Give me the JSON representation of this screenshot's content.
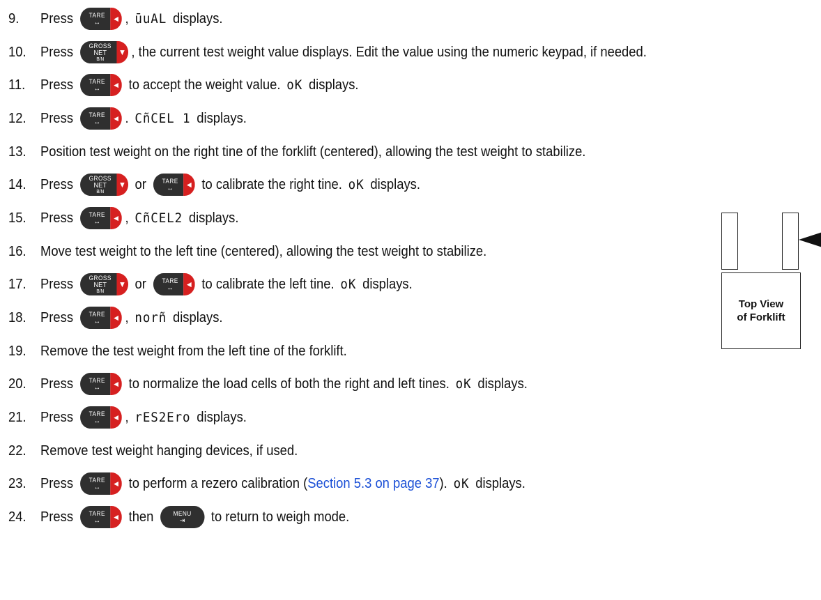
{
  "keys": {
    "tare": {
      "l1": "TARE",
      "l2": "↔",
      "cap": "◄"
    },
    "gross": {
      "l1": "GROSS",
      "l2": "NET",
      "l3": "B/N",
      "cap": "▼"
    },
    "menu": {
      "l1": "MENU",
      "l2": "⇥"
    }
  },
  "steps": [
    {
      "num": "9.",
      "parts": [
        {
          "t": "Press "
        },
        {
          "k": "tare"
        },
        {
          "t": ", "
        },
        {
          "s": "ūuAL"
        },
        {
          "t": " displays."
        }
      ]
    },
    {
      "num": "10.",
      "parts": [
        {
          "t": "Press "
        },
        {
          "k": "gross"
        },
        {
          "t": ", the current test weight value displays. Edit the value using the numeric keypad, if needed."
        }
      ]
    },
    {
      "num": "11.",
      "parts": [
        {
          "t": "Press "
        },
        {
          "k": "tare"
        },
        {
          "t": " to accept the weight value. "
        },
        {
          "s": "oK"
        },
        {
          "t": " displays."
        }
      ]
    },
    {
      "num": "12.",
      "parts": [
        {
          "t": "Press "
        },
        {
          "k": "tare"
        },
        {
          "t": ". "
        },
        {
          "s": "CñCEL 1"
        },
        {
          "t": " displays."
        }
      ]
    },
    {
      "num": "13.",
      "parts": [
        {
          "t": "Position test weight on the right tine of the forklift (centered), allowing the test weight to stabilize."
        }
      ]
    },
    {
      "num": "14.",
      "parts": [
        {
          "t": "Press "
        },
        {
          "k": "gross"
        },
        {
          "t": " or "
        },
        {
          "k": "tare"
        },
        {
          "t": " to calibrate the right tine. "
        },
        {
          "s": "oK"
        },
        {
          "t": " displays."
        }
      ]
    },
    {
      "num": "15.",
      "parts": [
        {
          "t": "Press "
        },
        {
          "k": "tare"
        },
        {
          "t": ", "
        },
        {
          "s": "CñCEL2"
        },
        {
          "t": " displays."
        }
      ]
    },
    {
      "num": "16.",
      "parts": [
        {
          "t": "Move test weight to the left tine (centered), allowing the test weight to stabilize."
        }
      ]
    },
    {
      "num": "17.",
      "parts": [
        {
          "t": "Press "
        },
        {
          "k": "gross"
        },
        {
          "t": " or "
        },
        {
          "k": "tare"
        },
        {
          "t": " to calibrate the left tine. "
        },
        {
          "s": "oK"
        },
        {
          "t": " displays."
        }
      ]
    },
    {
      "num": "18.",
      "parts": [
        {
          "t": "Press "
        },
        {
          "k": "tare"
        },
        {
          "t": ", "
        },
        {
          "s": "norñ"
        },
        {
          "t": " displays."
        }
      ]
    },
    {
      "num": "19.",
      "parts": [
        {
          "t": "Remove the test weight from the left tine of the forklift."
        }
      ]
    },
    {
      "num": "20.",
      "parts": [
        {
          "t": "Press "
        },
        {
          "k": "tare"
        },
        {
          "t": " to normalize the load cells of both the right and left tines. "
        },
        {
          "s": "oK"
        },
        {
          "t": " displays."
        }
      ]
    },
    {
      "num": "21.",
      "parts": [
        {
          "t": "Press "
        },
        {
          "k": "tare"
        },
        {
          "t": ", "
        },
        {
          "s": "rES2Ero"
        },
        {
          "t": " displays."
        }
      ]
    },
    {
      "num": "22.",
      "parts": [
        {
          "t": "Remove test weight hanging devices, if used."
        }
      ]
    },
    {
      "num": "23.",
      "parts": [
        {
          "t": "Press "
        },
        {
          "k": "tare"
        },
        {
          "t": " to perform a rezero calibration ("
        },
        {
          "link": "Section 5.3 on page 37"
        },
        {
          "t": "). "
        },
        {
          "s": "oK"
        },
        {
          "t": " displays."
        }
      ]
    },
    {
      "num": "24.",
      "parts": [
        {
          "t": "Press "
        },
        {
          "k": "tare"
        },
        {
          "t": " then "
        },
        {
          "k": "menu"
        },
        {
          "t": " to return to weigh mode."
        }
      ]
    }
  ],
  "diagram": {
    "line1": "Top View",
    "line2": "of Forklift"
  }
}
